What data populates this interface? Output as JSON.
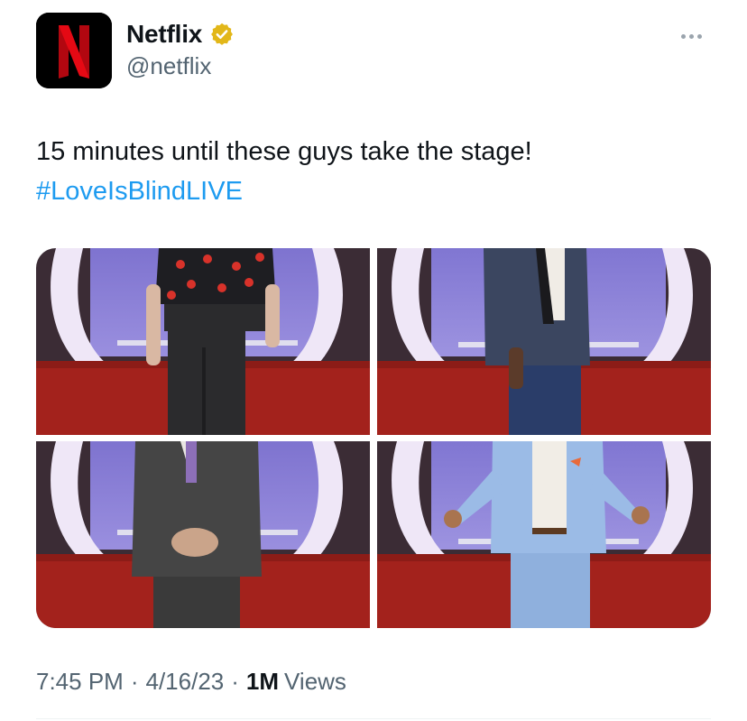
{
  "author": {
    "display_name": "Netflix",
    "handle": "@netflix",
    "logo_letter": "N",
    "verified": true
  },
  "tweet": {
    "text": "15 minutes until these guys take the stage!",
    "hashtag": "#LoveIsBlindLIVE"
  },
  "media": [
    {
      "label": "man in black heart-print shirt and dark trousers on stage"
    },
    {
      "label": "man in navy textured blazer on stage"
    },
    {
      "label": "man in dark grey suit with lavender tie on stage"
    },
    {
      "label": "man in light blue suit with arms outstretched on stage"
    }
  ],
  "meta": {
    "time": "7:45 PM",
    "separator": "·",
    "date": "4/16/23",
    "views_count": "1M",
    "views_label": "Views"
  },
  "colors": {
    "accent": "#1d9bf0",
    "netflix_red": "#e50914",
    "verified_gold": "#e2b719",
    "muted": "#536471"
  },
  "icons": {
    "more": "more-horizontal-icon",
    "verified": "verified-badge-icon",
    "logo": "netflix-logo"
  }
}
